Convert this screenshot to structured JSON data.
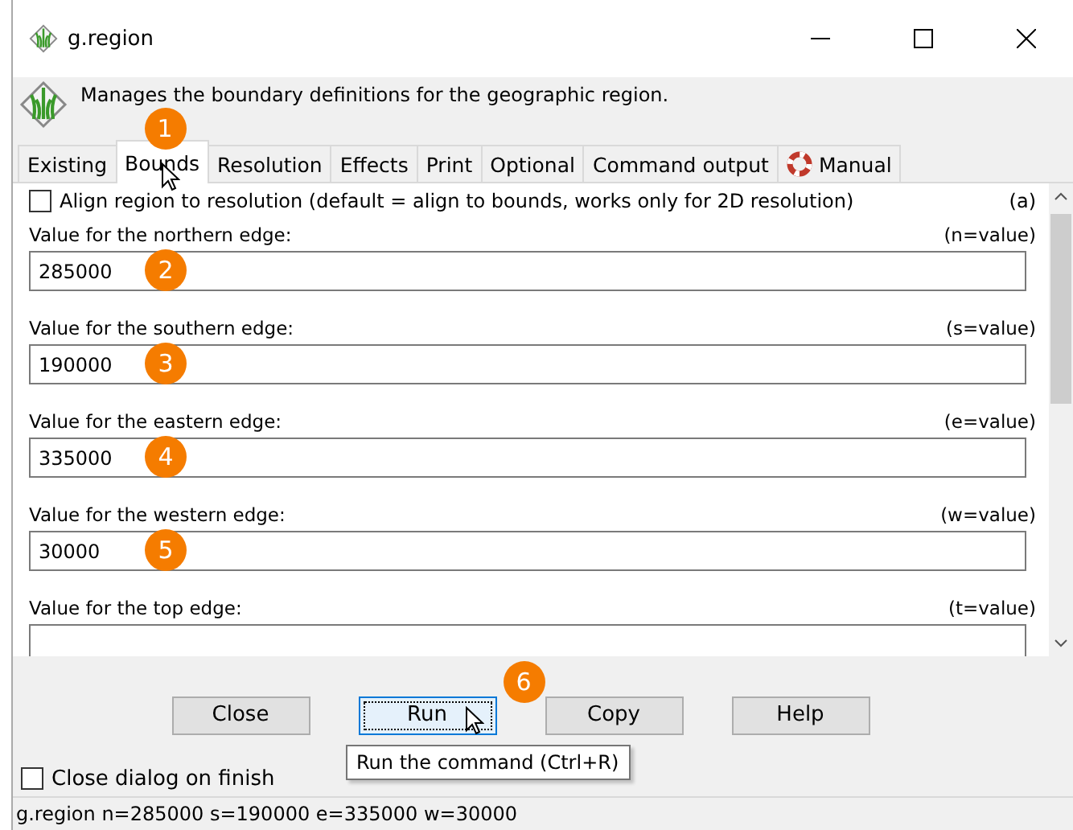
{
  "window": {
    "title": "g.region"
  },
  "description": "Manages the boundary definitions for the geographic region.",
  "tabs": [
    {
      "label": "Existing",
      "selected": false
    },
    {
      "label": "Bounds",
      "selected": true,
      "callout": "1",
      "pointer": true
    },
    {
      "label": "Resolution",
      "selected": false
    },
    {
      "label": "Effects",
      "selected": false
    },
    {
      "label": "Print",
      "selected": false
    },
    {
      "label": "Optional",
      "selected": false
    },
    {
      "label": "Command output",
      "selected": false
    },
    {
      "label": "Manual",
      "selected": false,
      "kind": "help"
    }
  ],
  "align_option": {
    "label": "Align region to resolution (default = align to bounds, works only for  2D resolution)",
    "flag": "(a)",
    "checked": false
  },
  "fields": [
    {
      "label": "Value for the northern edge:",
      "key": "(n=value)",
      "value": "285000",
      "callout": "2"
    },
    {
      "label": "Value for the southern edge:",
      "key": "(s=value)",
      "value": "190000",
      "callout": "3"
    },
    {
      "label": "Value for the eastern edge:",
      "key": "(e=value)",
      "value": "335000",
      "callout": "4"
    },
    {
      "label": "Value for the western edge:",
      "key": "(w=value)",
      "value": "30000",
      "callout": "5"
    },
    {
      "label": "Value for the top edge:",
      "key": "(t=value)"
    }
  ],
  "buttons": [
    {
      "label": "Close",
      "focused": false
    },
    {
      "label": "Run",
      "focused": true,
      "callout": "6",
      "pointer": true,
      "tooltip": "Run the command (Ctrl+R)"
    },
    {
      "label": "Copy",
      "focused": false
    },
    {
      "label": "Help",
      "focused": false
    }
  ],
  "close_on_finish": {
    "label": "Close dialog on finish",
    "checked": false
  },
  "status_bar": "g.region n=285000 s=190000 e=335000 w=30000"
}
